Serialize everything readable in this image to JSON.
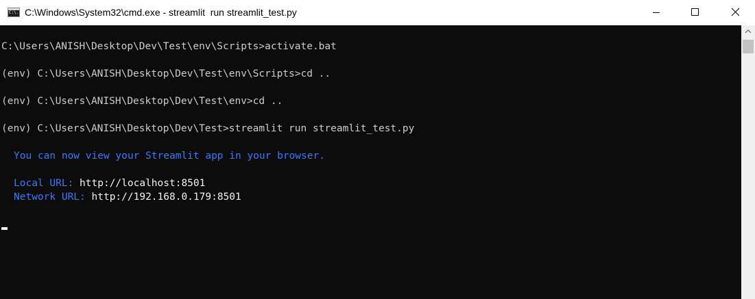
{
  "window": {
    "title": "C:\\Windows\\System32\\cmd.exe - streamlit  run streamlit_test.py",
    "icon_label": "C:\\."
  },
  "console": {
    "lines": [
      "C:\\Users\\ANISH\\Desktop\\Dev\\Test\\env\\Scripts>activate.bat",
      "(env) C:\\Users\\ANISH\\Desktop\\Dev\\Test\\env\\Scripts>cd ..",
      "(env) C:\\Users\\ANISH\\Desktop\\Dev\\Test\\env>cd ..",
      "(env) C:\\Users\\ANISH\\Desktop\\Dev\\Test>streamlit run streamlit_test.py"
    ],
    "streamlit": {
      "message": "You can now view your Streamlit app in your browser.",
      "local_label": "Local URL:",
      "local_url": "http://localhost:8501",
      "network_label": "Network URL:",
      "network_url": "http://192.168.0.179:8501"
    }
  },
  "icons": {
    "minimize": "minimize-icon",
    "maximize": "maximize-icon",
    "close": "close-icon",
    "scroll_up": "chevron-up-icon"
  },
  "colors": {
    "background": "#0c0c0c",
    "text": "#cccccc",
    "accent_blue": "#3b78ff",
    "titlebar": "#ffffff"
  }
}
